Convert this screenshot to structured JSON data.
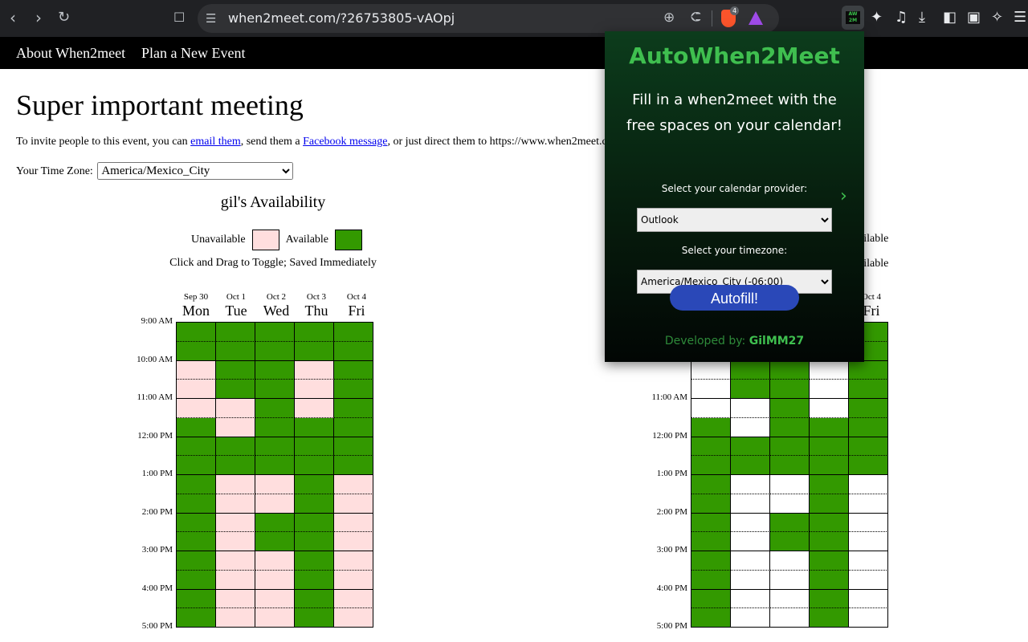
{
  "browser": {
    "url": "when2meet.com/?26753805-vAOpj",
    "brave_badge": "4"
  },
  "nav": {
    "about": "About When2meet",
    "plan": "Plan a New Event"
  },
  "event": {
    "title": "Super important meeting",
    "invite": {
      "prefix": "To invite people to this event, you can ",
      "email_link": "email them",
      "middle": ", send them a ",
      "facebook_link": "Facebook message",
      "suffix": ", or just direct them to https://www.when2meet.com/?26753805-vAOpj"
    },
    "timezone_label": "Your Time Zone:",
    "timezone_value": "America/Mexico_City"
  },
  "my_availability": {
    "title": "gil's Availability",
    "unavailable_label": "Unavailable",
    "available_label": "Available",
    "hint": "Click and Drag to Toggle; Saved Immediately"
  },
  "group_availability": {
    "unavailable_partial": "ailable",
    "available_partial": "ailable"
  },
  "columns": [
    {
      "date": "Sep 30",
      "day": "Mon"
    },
    {
      "date": "Oct 1",
      "day": "Tue"
    },
    {
      "date": "Oct 2",
      "day": "Wed"
    },
    {
      "date": "Oct 3",
      "day": "Thu"
    },
    {
      "date": "Oct 4",
      "day": "Fri"
    }
  ],
  "time_labels": [
    "9:00 AM",
    "10:00 AM",
    "11:00 AM",
    "12:00 PM",
    "1:00 PM",
    "2:00 PM",
    "3:00 PM",
    "4:00 PM",
    "5:00 PM"
  ],
  "availability_grid": [
    [
      1,
      1,
      1,
      1,
      1
    ],
    [
      1,
      1,
      1,
      1,
      1
    ],
    [
      0,
      1,
      1,
      0,
      1
    ],
    [
      0,
      1,
      1,
      0,
      1
    ],
    [
      0,
      0,
      1,
      0,
      1
    ],
    [
      1,
      0,
      1,
      1,
      1
    ],
    [
      1,
      1,
      1,
      1,
      1
    ],
    [
      1,
      1,
      1,
      1,
      1
    ],
    [
      1,
      0,
      0,
      1,
      0
    ],
    [
      1,
      0,
      0,
      1,
      0
    ],
    [
      1,
      0,
      1,
      1,
      0
    ],
    [
      1,
      0,
      1,
      1,
      0
    ],
    [
      1,
      0,
      0,
      1,
      0
    ],
    [
      1,
      0,
      0,
      1,
      0
    ],
    [
      1,
      0,
      0,
      1,
      0
    ],
    [
      1,
      0,
      0,
      1,
      0
    ]
  ],
  "colors": {
    "available": "#339900",
    "unavailable": "#ffdede",
    "group_empty": "#ffffff"
  },
  "extension": {
    "title": "AutoWhen2Meet",
    "subtitle": "Fill in a when2meet with the free spaces on your calendar!",
    "provider_label": "Select your calendar provider:",
    "provider_value": "Outlook",
    "timezone_label": "Select your timezone:",
    "timezone_value": "America/Mexico_City (-06:00)",
    "button": "Autofill!",
    "developer_prefix": "Developed by:",
    "developer_name": "GilMM27"
  }
}
